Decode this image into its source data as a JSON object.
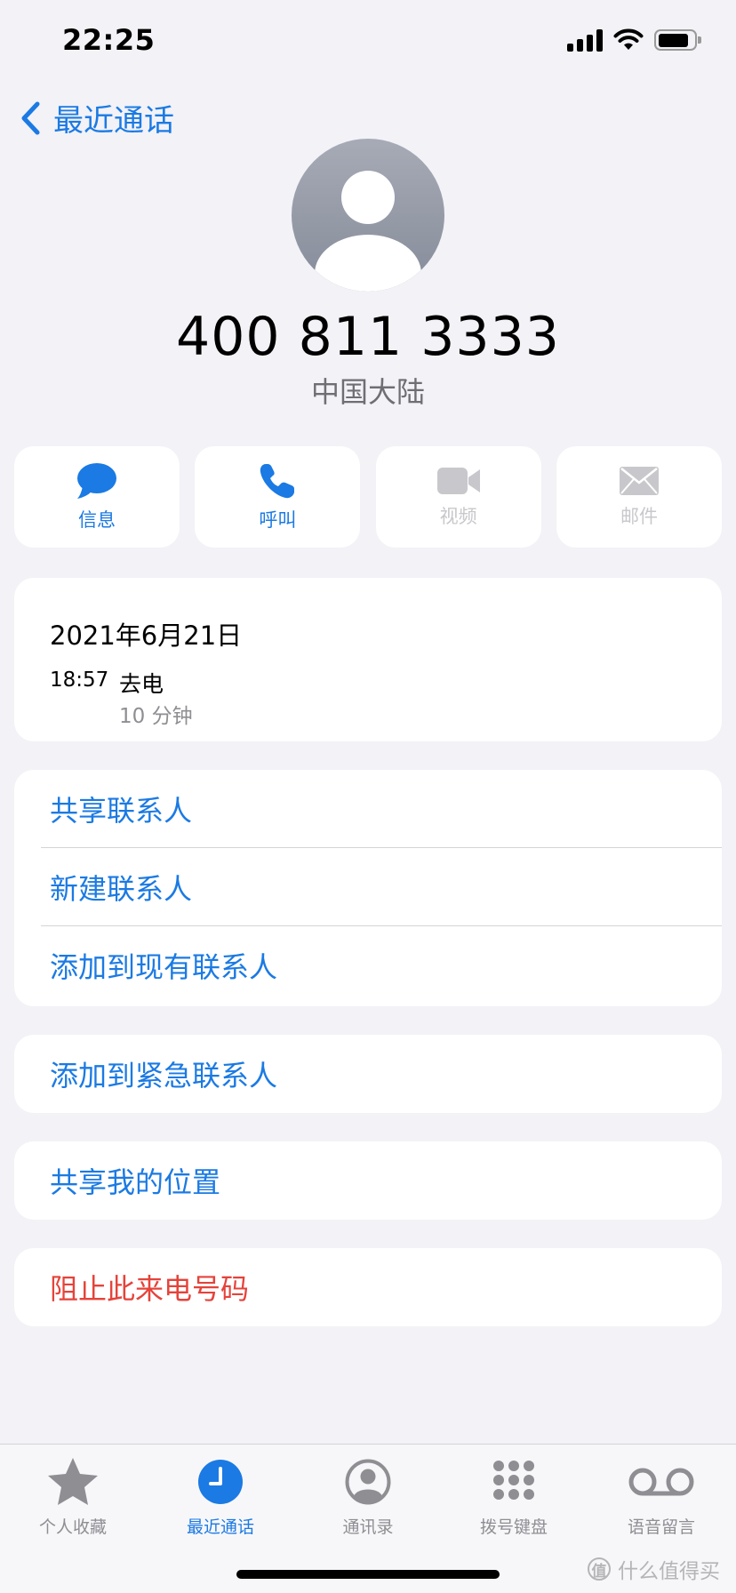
{
  "status_bar": {
    "time": "22:25",
    "battery_level": 0.85
  },
  "nav": {
    "back_label": "最近通话"
  },
  "contact": {
    "phone_number": "400 811 3333",
    "region": "中国大陆"
  },
  "actions": [
    {
      "label": "信息",
      "icon": "message-bubble-icon",
      "enabled": true
    },
    {
      "label": "呼叫",
      "icon": "phone-icon",
      "enabled": true
    },
    {
      "label": "视频",
      "icon": "video-camera-icon",
      "enabled": false
    },
    {
      "label": "邮件",
      "icon": "envelope-icon",
      "enabled": false
    }
  ],
  "recent_call": {
    "date": "2021年6月21日",
    "time": "18:57",
    "type": "去电",
    "duration": "10 分钟"
  },
  "menu": {
    "share_contact": "共享联系人",
    "new_contact": "新建联系人",
    "add_to_existing": "添加到现有联系人",
    "add_to_emergency": "添加到紧急联系人",
    "share_location": "共享我的位置",
    "block_caller": "阻止此来电号码"
  },
  "tabs": [
    {
      "label": "个人收藏",
      "icon": "star-icon",
      "active": false
    },
    {
      "label": "最近通话",
      "icon": "clock-icon",
      "active": true
    },
    {
      "label": "通讯录",
      "icon": "person-circle-icon",
      "active": false
    },
    {
      "label": "拨号键盘",
      "icon": "keypad-icon",
      "active": false
    },
    {
      "label": "语音留言",
      "icon": "voicemail-icon",
      "active": false
    }
  ],
  "watermark": {
    "mark": "值",
    "text": "什么值得买"
  },
  "colors": {
    "accent": "#1b7ae3",
    "danger": "#e5433a",
    "background": "#f2f2f7",
    "disabled": "#c8c8cc"
  }
}
